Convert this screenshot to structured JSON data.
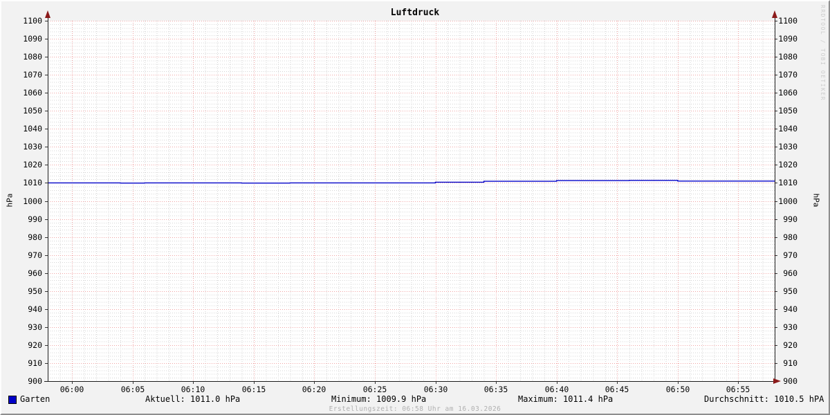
{
  "title": "Luftdruck",
  "watermark": "RRDTOOL / TOBI OETIKER",
  "axis_labels": {
    "left": "hPa",
    "right": "hPa"
  },
  "legend": {
    "swatch_color": "#0000c8",
    "series_label": "Garten",
    "current": "Aktuell: 1011.0 hPa",
    "minimum": "Minimum: 1009.9 hPa",
    "maximum": "Maximum: 1011.4 hPa",
    "average": "Durchschnitt: 1010.5 hPA"
  },
  "footer": "Erstellungszeit: 06:58 Uhr am 16.03.2026",
  "colors": {
    "background": "#f2f2f2",
    "plot_background": "#ffffff",
    "major_grid": "#f0a2a2",
    "minor_grid": "#d4d4d4",
    "axis": "#1a1a1a",
    "tick": "#333333",
    "arrow": "#8b1a1a",
    "line": "#0000c8",
    "watermark_text": "#cccccc",
    "footer_text": "#b0b0b0"
  },
  "chart_data": {
    "type": "line",
    "title": "Luftdruck",
    "xlabel": "",
    "ylabel": "hPa",
    "ylim": [
      900,
      1100
    ],
    "xlim": [
      "05:58",
      "06:58"
    ],
    "grid": true,
    "legend_position": "bottom",
    "y_ticks": [
      900,
      910,
      920,
      930,
      940,
      950,
      960,
      970,
      980,
      990,
      1000,
      1010,
      1020,
      1030,
      1040,
      1050,
      1060,
      1070,
      1080,
      1090,
      1100
    ],
    "x_ticks": [
      "06:00",
      "06:05",
      "06:10",
      "06:15",
      "06:20",
      "06:25",
      "06:30",
      "06:35",
      "06:40",
      "06:45",
      "06:50",
      "06:55"
    ],
    "y_minor_step": 2,
    "x_minor_step_minutes": 1,
    "series": [
      {
        "name": "Garten",
        "unit": "hPa",
        "color": "#0000c8",
        "draw_style": "step-after",
        "points": [
          [
            "05:58",
            1010.0
          ],
          [
            "06:04",
            1009.9
          ],
          [
            "06:06",
            1010.0
          ],
          [
            "06:14",
            1009.9
          ],
          [
            "06:18",
            1010.0
          ],
          [
            "06:30",
            1010.4
          ],
          [
            "06:34",
            1010.9
          ],
          [
            "06:40",
            1011.3
          ],
          [
            "06:46",
            1011.4
          ],
          [
            "06:50",
            1011.0
          ],
          [
            "06:58",
            1011.0
          ]
        ],
        "stats": {
          "current": 1011.0,
          "minimum": 1009.9,
          "maximum": 1011.4,
          "average": 1010.5
        }
      }
    ]
  }
}
